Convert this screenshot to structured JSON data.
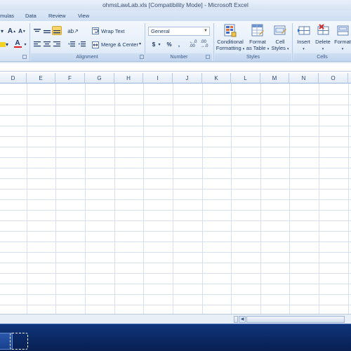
{
  "window": {
    "title": "ohmsLawLab.xls  [Compatibility Mode] - Microsoft Excel"
  },
  "ribbon_tabs": [
    "mulas",
    "Data",
    "Review",
    "View"
  ],
  "alignment": {
    "label": "Alignment",
    "wrap_text": "Wrap Text",
    "merge_center": "Merge & Center"
  },
  "number": {
    "label": "Number",
    "format": "General",
    "currency": "$",
    "percent": "%",
    "comma": ","
  },
  "styles": {
    "label": "Styles",
    "conditional_1": "Conditional",
    "conditional_2": "Formatting",
    "format_table_1": "Format",
    "format_table_2": "as Table",
    "cell_styles_1": "Cell",
    "cell_styles_2": "Styles"
  },
  "cells": {
    "label": "Cells",
    "insert": "Insert",
    "delete": "Delete",
    "format": "Format"
  },
  "font": {
    "grow": "A",
    "shrink": "A",
    "font_color": "A"
  },
  "columns": [
    "D",
    "E",
    "F",
    "G",
    "H",
    "I",
    "J",
    "K",
    "L",
    "M",
    "N",
    "O"
  ],
  "colors": {
    "highlight": "#f7d56a",
    "font_color_bar": "#e02020",
    "taskbar": "#0b2a66"
  }
}
